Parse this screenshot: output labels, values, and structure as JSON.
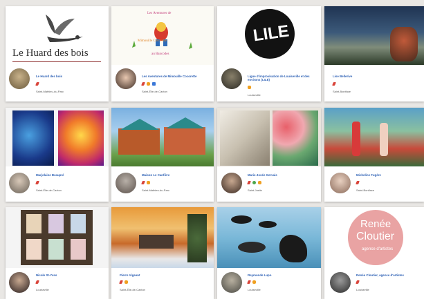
{
  "cards": [
    {
      "name": "Le Huard des bois",
      "location": "Saint-Mathieu-du-Parc",
      "logo_text": "Le Huard des bois",
      "icons": [
        "pencil-icon"
      ]
    },
    {
      "name": "Les Aventures de Mimouille Cocorette",
      "location": "Saint-Élie-de-Caxton",
      "logo_text_top": "Les Aventures de",
      "logo_text_mid": "Mimouille Cocorette",
      "logo_text_bottom": "au Bancodes",
      "icons": [
        "pencil-icon",
        "orange-icon",
        "blue-icon"
      ]
    },
    {
      "name": "Ligue d'improvisation de Louiseville et des environs (LILE)",
      "location": "Louiseville",
      "logo_text": "LILE",
      "icons": [
        "orange-icon"
      ]
    },
    {
      "name": "Lise Bellerive",
      "location": "Saint-Boniface",
      "icons": [
        "pencil-icon"
      ]
    },
    {
      "name": "Marjolaine Beaupré",
      "location": "Saint-Élie-de-Caxton",
      "icons": [
        "pencil-icon"
      ]
    },
    {
      "name": "Maison Le Canfière",
      "location": "Saint-Mathieu-du-Parc",
      "icons": [
        "pencil-icon",
        "orange-icon"
      ]
    },
    {
      "name": "Marie-Josée Gervais",
      "location": "Saint-Justin",
      "icons": [
        "pencil-icon",
        "green-icon",
        "orange-icon"
      ]
    },
    {
      "name": "Micheline Fugère",
      "location": "Saint-Boniface",
      "icons": [
        "pencil-icon"
      ]
    },
    {
      "name": "Nicole St-Yves",
      "location": "Louiseville",
      "icons": [
        "pencil-icon"
      ]
    },
    {
      "name": "Pierre Vigeant",
      "location": "Saint-Élie-de-Caxton",
      "icons": [
        "pencil-icon",
        "orange-icon"
      ]
    },
    {
      "name": "Raymonde Lupo",
      "location": "Louiseville",
      "icons": [
        "pencil-icon",
        "orange-icon"
      ]
    },
    {
      "name": "Renée Cloutier, agence d'artistes",
      "location": "Louiseville",
      "logo_text_1": "Renée",
      "logo_text_2": "Cloutier",
      "logo_text_3": "agence d'artistes",
      "icons": [
        "pencil-icon"
      ]
    }
  ],
  "colors": {
    "link": "#2b5fb4",
    "pencil": "#d9443a",
    "orange": "#f0a020",
    "blue": "#3b78d8",
    "green": "#4ca64c",
    "pink": "#e9a3a3"
  }
}
